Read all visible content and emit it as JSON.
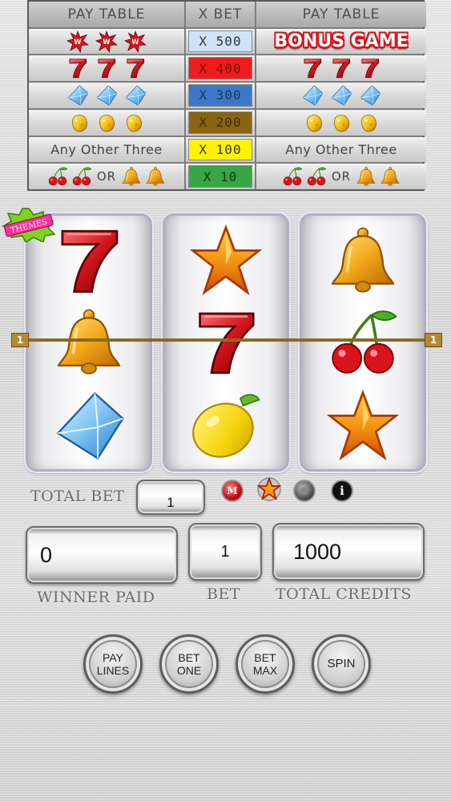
{
  "pay_table": {
    "headers": {
      "left": "PAY TABLE",
      "middle": "X BET",
      "right": "PAY TABLE"
    },
    "rows": [
      {
        "left_symbols": [
          "wild-icon",
          "wild-icon",
          "wild-icon"
        ],
        "multiplier": "X 500",
        "color": "#cfe3f6",
        "right_label": "BONUS GAME"
      },
      {
        "left_symbols": [
          "seven-icon",
          "seven-icon",
          "seven-icon"
        ],
        "multiplier": "X 400",
        "color": "#ee1c1c",
        "right_symbols": [
          "seven-icon",
          "seven-icon",
          "seven-icon"
        ]
      },
      {
        "left_symbols": [
          "diamond-icon",
          "diamond-icon",
          "diamond-icon"
        ],
        "multiplier": "X 300",
        "color": "#3d78c8",
        "right_symbols": [
          "diamond-icon",
          "diamond-icon",
          "diamond-icon"
        ]
      },
      {
        "left_symbols": [
          "gold-nugget-icon",
          "gold-nugget-icon",
          "gold-nugget-icon"
        ],
        "multiplier": "X 200",
        "color": "#8a6410",
        "right_symbols": [
          "gold-nugget-icon",
          "gold-nugget-icon",
          "gold-nugget-icon"
        ]
      },
      {
        "left_text": "Any Other Three",
        "multiplier": "X 100",
        "color": "#fff200",
        "right_text": "Any Other Three"
      },
      {
        "left_symbols": [
          "cherry-icon",
          "cherry-icon",
          "bell-icon",
          "bell-icon"
        ],
        "or_text": "OR",
        "multiplier": "X 10",
        "color": "#36a744"
      }
    ]
  },
  "themes_badge": "THEMES",
  "reels": [
    [
      "seven-icon",
      "bell-icon",
      "diamond-icon"
    ],
    [
      "star-icon",
      "seven-icon",
      "lemon-icon"
    ],
    [
      "bell-icon",
      "cherry-icon",
      "star-icon"
    ]
  ],
  "payline": {
    "left_tag": "1",
    "right_tag": "1"
  },
  "controls": {
    "total_bet_label": "TOTAL BET",
    "total_bet_value": "1",
    "menu_button": "M",
    "info_button": "i",
    "winner_paid_label": "WINNER PAID",
    "winner_paid_value": "0",
    "bet_label": "BET",
    "bet_value": "1",
    "total_credits_label": "TOTAL CREDITS",
    "total_credits_value": "1000"
  },
  "buttons": {
    "pay_lines": [
      "PAY",
      "LINES"
    ],
    "bet_one": [
      "BET",
      "ONE"
    ],
    "bet_max": [
      "BET",
      "MAX"
    ],
    "spin": "SPIN"
  }
}
